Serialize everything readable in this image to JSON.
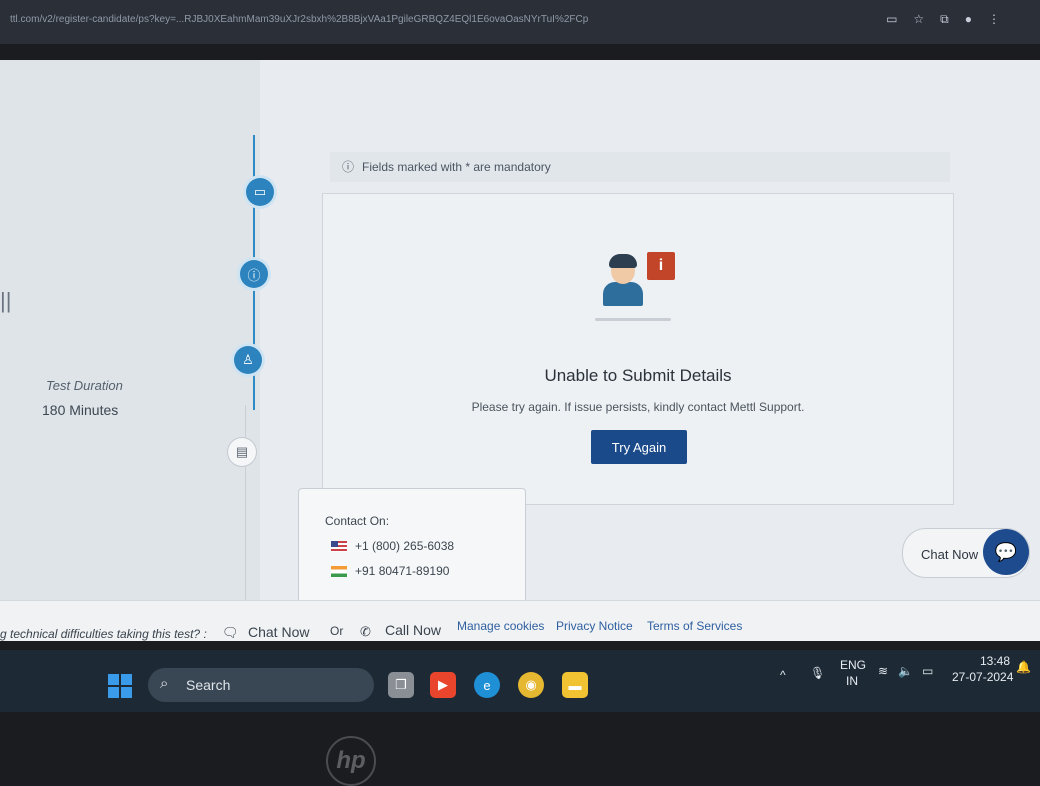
{
  "browser": {
    "url": "ttl.com/v2/register-candidate/ps?key=...RJBJ0XEahmMam39uXJr2sbxh%2B8BjxVAa1PgileGRBQZ4EQl1E6ovaOasNYrTuI%2FCp"
  },
  "sidebar": {
    "test_duration_label": "Test Duration",
    "test_duration_value": "180  Minutes",
    "bars": "||"
  },
  "notice": {
    "text": "Fields marked with * are mandatory"
  },
  "error_card": {
    "title": "Unable to Submit Details",
    "message": "Please try again. If issue persists, kindly contact Mettl Support.",
    "try_again_label": "Try Again",
    "badge": "i"
  },
  "contact_popup": {
    "heading": "Contact On:",
    "phones": [
      {
        "flag": "us",
        "number": "+1 (800) 265-6038"
      },
      {
        "flag": "in",
        "number": "+91 80471-89190"
      }
    ]
  },
  "chat_widget": {
    "label": "Chat Now"
  },
  "footer": {
    "lead": "g technical difficulties taking this test? :",
    "chat_now": "Chat Now",
    "or": "Or",
    "call_now": "Call Now",
    "manage_cookies": "Manage cookies",
    "privacy_notice": "Privacy Notice",
    "terms": "Terms of Services"
  },
  "taskbar": {
    "search_label": "Search",
    "lang_top": "ENG",
    "lang_bottom": "IN",
    "time": "13:48",
    "date": "27-07-2024"
  },
  "colors": {
    "accent": "#2c83bd",
    "button": "#1a4a8a",
    "badge": "#c2452a"
  },
  "device_logo": "hp"
}
